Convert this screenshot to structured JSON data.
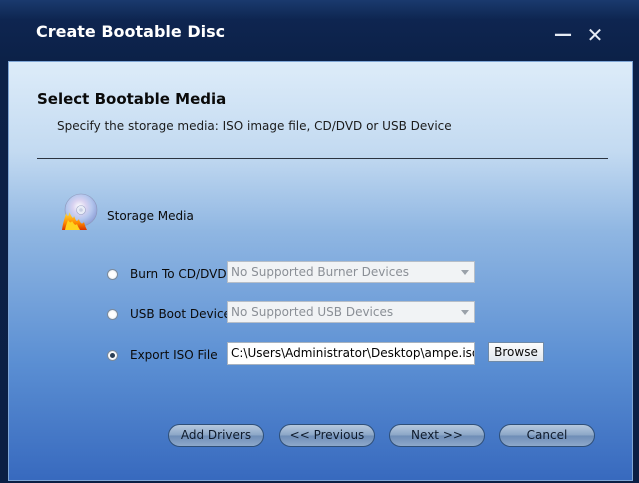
{
  "window": {
    "title": "Create Bootable Disc",
    "minimize_glyph": "—",
    "close_glyph": "✕"
  },
  "header": {
    "title": "Select Bootable Media",
    "subtitle": "Specify the storage media: ISO image file, CD/DVD or USB Device"
  },
  "media": {
    "label": "Storage Media",
    "icon": "burning-disc-icon"
  },
  "options": {
    "burn": {
      "label": "Burn To CD/DVD",
      "checked": false,
      "dropdown_value": "No Supported Burner Devices"
    },
    "usb": {
      "label": "USB Boot Device",
      "checked": false,
      "dropdown_value": "No Supported USB Devices"
    },
    "iso": {
      "label": "Export ISO File",
      "checked": true,
      "path_value": "C:\\Users\\Administrator\\Desktop\\ampe.iso",
      "browse_label": "Browse"
    }
  },
  "footer": {
    "add_drivers": "Add Drivers",
    "previous": "<< Previous",
    "next": "Next >>",
    "cancel": "Cancel"
  }
}
